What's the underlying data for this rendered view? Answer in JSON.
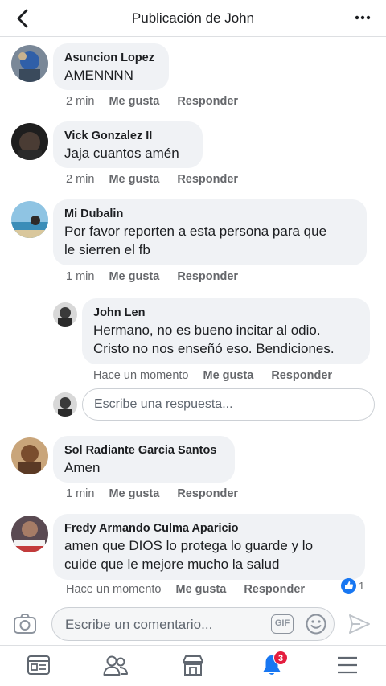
{
  "header": {
    "title": "Publicación de John"
  },
  "comments": [
    {
      "name": "Asuncion Lopez",
      "text": "AMENNNN",
      "time": "2 min",
      "like": "Me gusta",
      "reply": "Responder"
    },
    {
      "name": "Vick Gonzalez II",
      "text": "Jaja cuantos amén",
      "time": "2 min",
      "like": "Me gusta",
      "reply": "Responder"
    },
    {
      "name": "Mi Dubalin",
      "text_line1": "Por favor reporten a esta persona para que",
      "text_line2": "le sierren el fb",
      "time": "1 min",
      "like": "Me gusta",
      "reply": "Responder"
    },
    {
      "name": "John Len",
      "text_line1": "Hermano, no es bueno incitar al odio.",
      "text_line2": "Cristo no nos enseñó eso. Bendiciones.",
      "time": "Hace un momento",
      "like": "Me gusta",
      "reply": "Responder"
    },
    {
      "name": "Sol Radiante Garcia Santos",
      "text": "Amen",
      "time": "1 min",
      "like": "Me gusta",
      "reply": "Responder"
    },
    {
      "name": "Fredy Armando Culma Aparicio",
      "text_line1": "amen  que DIOS lo protega lo  guarde  y lo",
      "text_line2": "cuide que le mejore  mucho la  salud",
      "time": "Hace un momento",
      "like": "Me gusta",
      "reply": "Responder",
      "reaction_count": "1"
    }
  ],
  "reply_box": {
    "placeholder": "Escribe una respuesta..."
  },
  "composer": {
    "placeholder": "Escribe un comentario...",
    "gif_label": "GIF"
  },
  "tabbar": {
    "notifications_badge": "3"
  },
  "colors": {
    "accent": "#1877f2",
    "badge": "#e41e3f",
    "bubble": "#f0f2f5"
  },
  "icons": [
    "back-arrow-icon",
    "more-options-icon",
    "camera-icon",
    "gif-icon",
    "emoji-icon",
    "send-icon",
    "news-feed-icon",
    "friends-icon",
    "marketplace-icon",
    "notifications-bell-icon",
    "menu-icon",
    "like-reaction-icon"
  ]
}
